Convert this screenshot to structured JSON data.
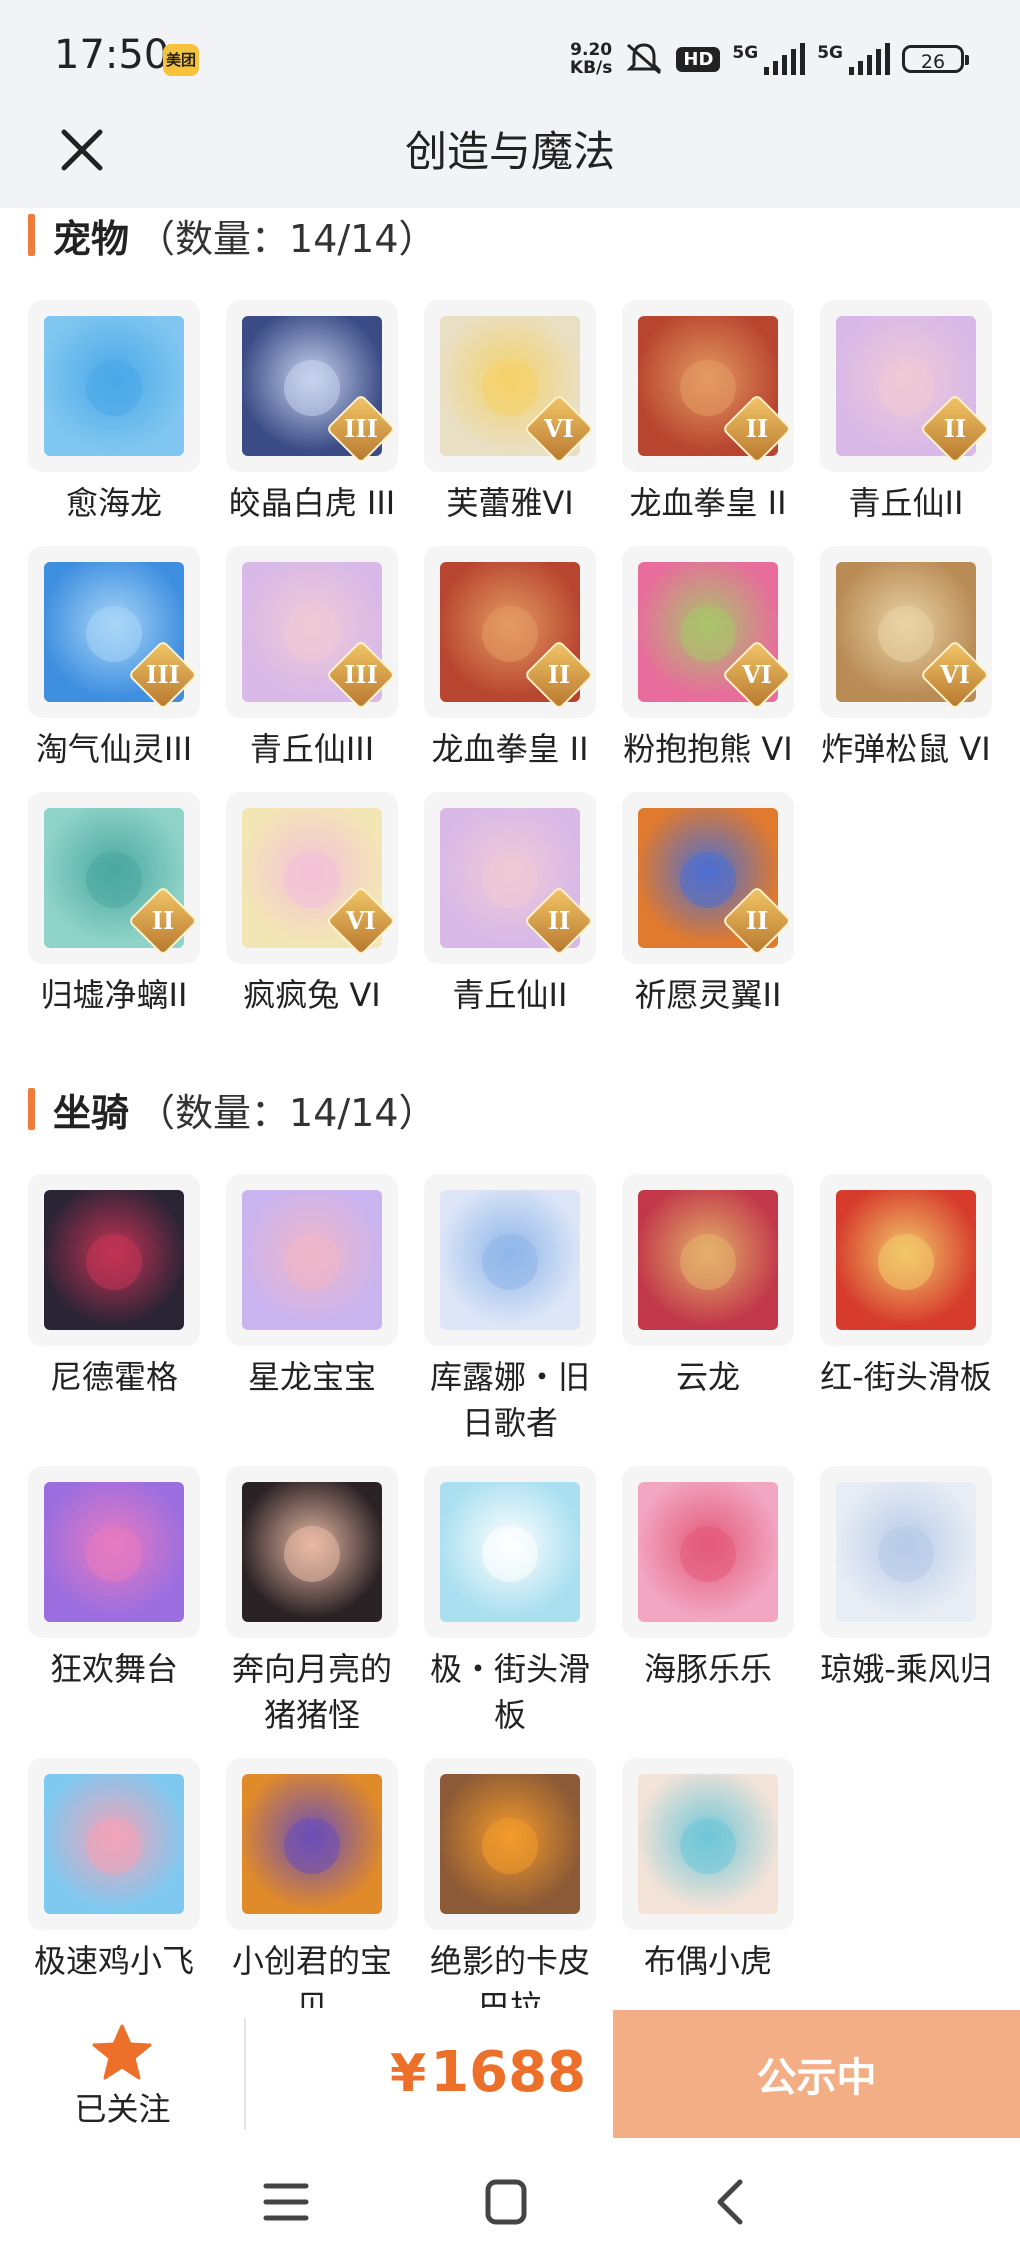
{
  "status_bar": {
    "time": "17:50",
    "app_badge": "美团",
    "net_speed_value": "9.20",
    "net_speed_unit": "KB/s",
    "hd_label": "HD",
    "sim1_label": "5G",
    "sim2_label": "5G",
    "battery": "26"
  },
  "header": {
    "title": "创造与魔法",
    "close_icon": "close-icon"
  },
  "pets": {
    "name": "宠物",
    "count": "（数量：14/14）",
    "items": [
      {
        "label": "愈海龙",
        "rank": "",
        "color": "#7fc6f0",
        "accent": "#4aa8e8"
      },
      {
        "label": "皎晶白虎 III",
        "rank": "III",
        "color": "#3a4b86",
        "accent": "#c9d3ee"
      },
      {
        "label": "芙蕾雅VI",
        "rank": "VI",
        "color": "#e9dfc4",
        "accent": "#f4d26a"
      },
      {
        "label": "龙血拳皇 II",
        "rank": "II",
        "color": "#b8452f",
        "accent": "#e39a62"
      },
      {
        "label": "青丘仙II",
        "rank": "II",
        "color": "#d8b9e8",
        "accent": "#f1c9d6"
      },
      {
        "label": "淘气仙灵III",
        "rank": "III",
        "color": "#3f8fe0",
        "accent": "#a8d6f7"
      },
      {
        "label": "青丘仙III",
        "rank": "III",
        "color": "#d8b9e8",
        "accent": "#f1c9d6"
      },
      {
        "label": "龙血拳皇 II",
        "rank": "II",
        "color": "#b8452f",
        "accent": "#e39a62"
      },
      {
        "label": "粉抱抱熊 VI",
        "rank": "VI",
        "color": "#e86c9c",
        "accent": "#a9c46a"
      },
      {
        "label": "炸弹松鼠 VI",
        "rank": "VI",
        "color": "#b98b55",
        "accent": "#e9d3a6"
      },
      {
        "label": "归墟净螭II",
        "rank": "II",
        "color": "#8fd3c8",
        "accent": "#4aa8a0"
      },
      {
        "label": "疯疯兔 VI",
        "rank": "VI",
        "color": "#f3e6b5",
        "accent": "#f3c1d8"
      },
      {
        "label": "青丘仙II",
        "rank": "II",
        "color": "#d8b9e8",
        "accent": "#f1c9d6"
      },
      {
        "label": "祈愿灵翼II",
        "rank": "II",
        "color": "#e07a2e",
        "accent": "#4d6fd1"
      }
    ]
  },
  "mounts": {
    "name": "坐骑",
    "count": "（数量：14/14）",
    "items": [
      {
        "label": "尼德霍格",
        "rank": "",
        "color": "#2a2435",
        "accent": "#c43355"
      },
      {
        "label": "星龙宝宝",
        "rank": "",
        "color": "#c9b4f0",
        "accent": "#f0b6c8"
      },
      {
        "label": "库露娜・旧日歌者",
        "rank": "",
        "color": "#dde6f7",
        "accent": "#8fb6ea"
      },
      {
        "label": "云龙",
        "rank": "",
        "color": "#c2384a",
        "accent": "#e4b06a"
      },
      {
        "label": "红-街头滑板",
        "rank": "",
        "color": "#d63b2c",
        "accent": "#f2c86a"
      },
      {
        "label": "狂欢舞台",
        "rank": "",
        "color": "#9b6ee0",
        "accent": "#e87ac0"
      },
      {
        "label": "奔向月亮的猪猪怪",
        "rank": "",
        "color": "#2b2226",
        "accent": "#e8b9a4"
      },
      {
        "label": "极・街头滑板",
        "rank": "",
        "color": "#a9dff0",
        "accent": "#ffffff"
      },
      {
        "label": "海豚乐乐",
        "rank": "",
        "color": "#f2a6c2",
        "accent": "#e35a7a"
      },
      {
        "label": "琼娥-乘风归",
        "rank": "",
        "color": "#e8edf5",
        "accent": "#b8cbe8"
      },
      {
        "label": "极速鸡小飞",
        "rank": "",
        "color": "#7fc9f0",
        "accent": "#f3a3b8"
      },
      {
        "label": "小创君的宝贝",
        "rank": "",
        "color": "#e08a2a",
        "accent": "#6b4fb8"
      },
      {
        "label": "绝影的卡皮巴拉",
        "rank": "",
        "color": "#8c5a36",
        "accent": "#f39a2c"
      },
      {
        "label": "布偶小虎",
        "rank": "",
        "color": "#f3e3d8",
        "accent": "#6fc6d8"
      }
    ]
  },
  "bottom_bar": {
    "follow_label": "已关注",
    "price_symbol": "¥",
    "price_value": "1688",
    "publish_label": "公示中"
  },
  "system_nav": {
    "menu": "menu-icon",
    "home": "home-icon",
    "back": "back-icon"
  }
}
